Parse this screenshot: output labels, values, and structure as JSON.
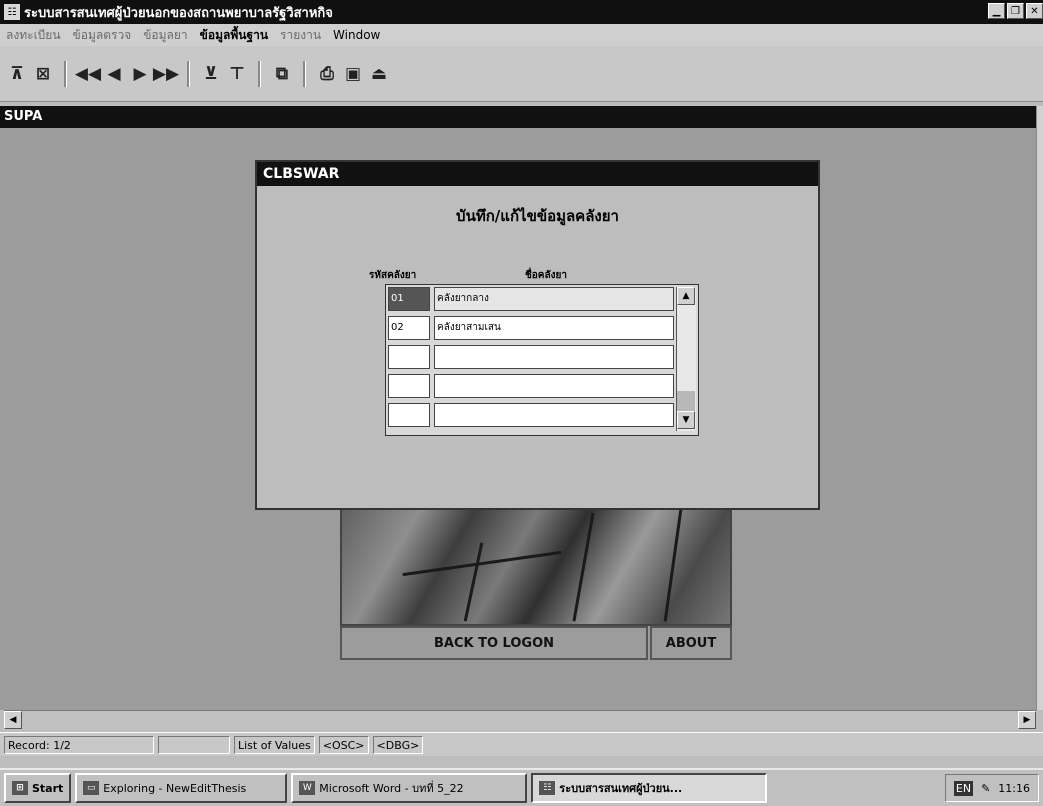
{
  "window": {
    "title": "ระบบสารสนเทศผู้ป่วยนอกของสถานพยาบาลรัฐวิสาหกิจ",
    "icon_glyph": "☷"
  },
  "menu": [
    {
      "label": "ลงทะเบียน",
      "active": false
    },
    {
      "label": "ข้อมูลตรวจ",
      "active": false
    },
    {
      "label": "ข้อมูลยา",
      "active": false
    },
    {
      "label": "ข้อมูลพื้นฐาน",
      "active": true
    },
    {
      "label": "รายงาน",
      "active": false
    },
    {
      "label": "Window",
      "active": false
    }
  ],
  "inner_window": {
    "title": "SUPA"
  },
  "dialog": {
    "title": "CLBSWAR",
    "heading": "บันทึก/แก้ไขข้อมูลคลังยา",
    "col_code": "รหัสคลังยา",
    "col_name": "ชื่อคลังยา",
    "rows": [
      {
        "code": "01",
        "name": "คลังยากลาง"
      },
      {
        "code": "02",
        "name": "คลังยาสามเสน"
      },
      {
        "code": "",
        "name": ""
      },
      {
        "code": "",
        "name": ""
      },
      {
        "code": "",
        "name": ""
      }
    ]
  },
  "buttons": {
    "back": "BACK TO LOGON",
    "about": "ABOUT"
  },
  "status": {
    "record": "Record: 1/2",
    "lov": "List of Values",
    "osc": "<OSC>",
    "dbg": "<DBG>"
  },
  "taskbar": {
    "start": "Start",
    "tasks": [
      {
        "label": "Exploring - NewEditThesis"
      },
      {
        "label": "Microsoft Word - บทที่ 5_22"
      },
      {
        "label": "ระบบสารสนเทศผู้ป่วยน..."
      }
    ],
    "lang": "EN",
    "clock": "11:16"
  }
}
